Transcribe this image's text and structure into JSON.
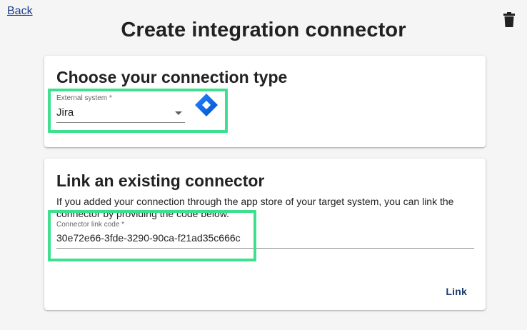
{
  "nav": {
    "back_label": "Back"
  },
  "page": {
    "title": "Create integration connector"
  },
  "connection_type_card": {
    "title": "Choose your connection type",
    "external_system": {
      "label": "External system *",
      "value": "Jira"
    }
  },
  "link_card": {
    "title": "Link an existing connector",
    "description": "If you added your connection through the app store of your target system, you can link the connector by providing the code below.",
    "link_code": {
      "label": "Connector link code *",
      "value": "30e72e66-3fde-3290-90ca-f21ad35c666c"
    },
    "link_button_label": "Link"
  },
  "icons": {
    "delete": "trash-icon",
    "jira": "jira-logo"
  },
  "colors": {
    "highlight": "#3ee08f",
    "link": "#1a3c8f",
    "jira_blue": "#2684ff"
  }
}
